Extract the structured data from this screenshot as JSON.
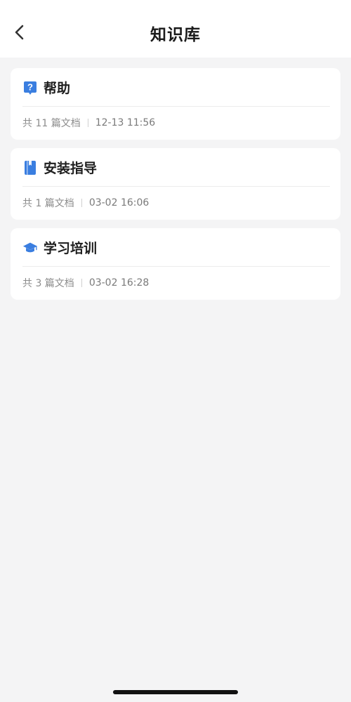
{
  "header": {
    "title": "知识库",
    "back_icon": "chevron-left-icon"
  },
  "knowledge_bases": [
    {
      "icon": "help-question-icon",
      "title": "帮助",
      "doc_count": "共 11 篇文档",
      "updated": "12-13 11:56"
    },
    {
      "icon": "book-icon",
      "title": "安装指导",
      "doc_count": "共 1 篇文档",
      "updated": "03-02 16:06"
    },
    {
      "icon": "graduation-cap-icon",
      "title": "学习培训",
      "doc_count": "共 3 篇文档",
      "updated": "03-02 16:28"
    }
  ],
  "colors": {
    "accent": "#3a7ee0",
    "background": "#f4f4f5",
    "card": "#ffffff",
    "meta_text": "#8c8c8c"
  }
}
